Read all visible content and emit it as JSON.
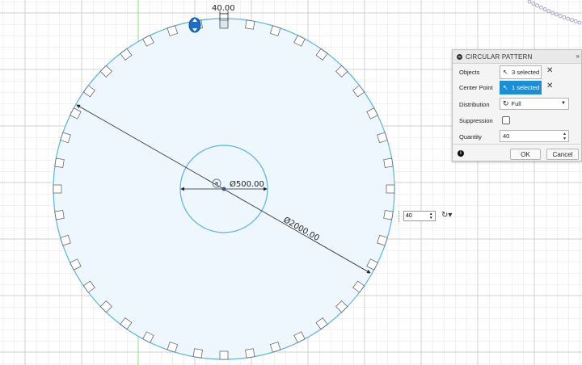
{
  "dialog": {
    "title": "CIRCULAR PATTERN",
    "expand_icon": "double-chevron-right",
    "rows": {
      "objects": {
        "label": "Objects",
        "value": "3 selected"
      },
      "center_point": {
        "label": "Center Point",
        "value": "1 selected"
      },
      "distribution": {
        "label": "Distribution",
        "value": "Full"
      },
      "suppression": {
        "label": "Suppression",
        "checked": false
      },
      "quantity": {
        "label": "Quantity",
        "value": "40"
      }
    },
    "ok_label": "OK",
    "cancel_label": "Cancel",
    "accent_color": "#1b8fd6"
  },
  "canvas": {
    "dim_top": "40.00",
    "dim_inner": "Ø500.00",
    "dim_outer": "Ø2000.00",
    "mini_quantity": "40",
    "sketch_color": "#5ab4dc",
    "fill_color": "#eef7fd",
    "axis_color": "#7fdc7f"
  }
}
